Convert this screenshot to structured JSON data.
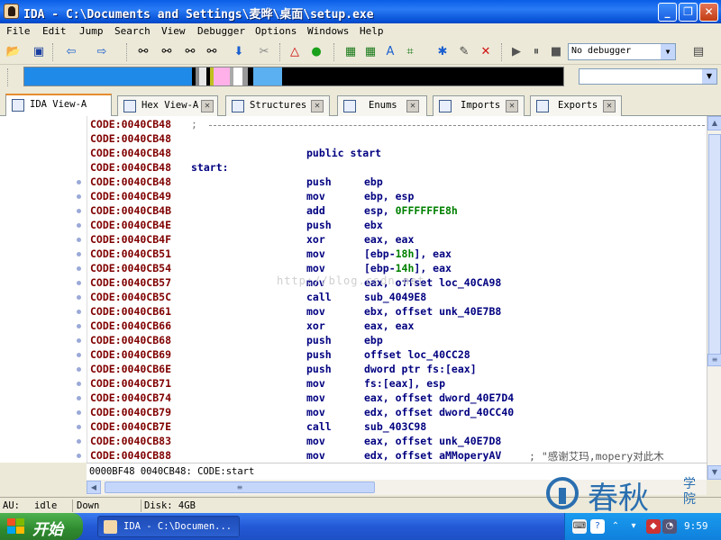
{
  "window": {
    "title": "IDA - C:\\Documents and Settings\\麦晔\\桌面\\setup.exe"
  },
  "menu": [
    "File",
    "Edit",
    "Jump",
    "Search",
    "View",
    "Debugger",
    "Options",
    "Windows",
    "Help"
  ],
  "toolbar": {
    "debugger_select": "No debugger"
  },
  "tabs": [
    {
      "label": "IDA View-A",
      "active": true
    },
    {
      "label": "Hex View-A",
      "active": false
    },
    {
      "label": "Structures",
      "active": false
    },
    {
      "label": "Enums",
      "active": false
    },
    {
      "label": "Imports",
      "active": false
    },
    {
      "label": "Exports",
      "active": false
    }
  ],
  "disasm": {
    "lines": [
      {
        "addr": "CODE:0040CB48",
        "label": ";",
        "mn": "",
        "op": "",
        "sep": true
      },
      {
        "addr": "CODE:0040CB48",
        "label": "",
        "mn": "",
        "op": ""
      },
      {
        "addr": "CODE:0040CB48",
        "label": "",
        "mn": "public start",
        "op": ""
      },
      {
        "addr": "CODE:0040CB48",
        "label": "start:",
        "mn": "",
        "op": ""
      },
      {
        "addr": "CODE:0040CB48",
        "label": "",
        "mn": "push",
        "op": "ebp"
      },
      {
        "addr": "CODE:0040CB49",
        "label": "",
        "mn": "mov",
        "op": "ebp, esp"
      },
      {
        "addr": "CODE:0040CB4B",
        "label": "",
        "mn": "add",
        "op": "esp, ",
        "num": "0FFFFFFE8h",
        "op2": ""
      },
      {
        "addr": "CODE:0040CB4E",
        "label": "",
        "mn": "push",
        "op": "ebx"
      },
      {
        "addr": "CODE:0040CB4F",
        "label": "",
        "mn": "xor",
        "op": "eax, eax"
      },
      {
        "addr": "CODE:0040CB51",
        "label": "",
        "mn": "mov",
        "op": "[ebp-",
        "num": "18h",
        "op2": "], eax"
      },
      {
        "addr": "CODE:0040CB54",
        "label": "",
        "mn": "mov",
        "op": "[ebp-",
        "num": "14h",
        "op2": "], eax"
      },
      {
        "addr": "CODE:0040CB57",
        "label": "",
        "mn": "mov",
        "op": "eax, offset loc_40CA98"
      },
      {
        "addr": "CODE:0040CB5C",
        "label": "",
        "mn": "call",
        "op": "sub_4049E8"
      },
      {
        "addr": "CODE:0040CB61",
        "label": "",
        "mn": "mov",
        "op": "ebx, offset unk_40E7B8"
      },
      {
        "addr": "CODE:0040CB66",
        "label": "",
        "mn": "xor",
        "op": "eax, eax"
      },
      {
        "addr": "CODE:0040CB68",
        "label": "",
        "mn": "push",
        "op": "ebp"
      },
      {
        "addr": "CODE:0040CB69",
        "label": "",
        "mn": "push",
        "op": "offset loc_40CC28"
      },
      {
        "addr": "CODE:0040CB6E",
        "label": "",
        "mn": "push",
        "op": "dword ptr fs:[eax]"
      },
      {
        "addr": "CODE:0040CB71",
        "label": "",
        "mn": "mov",
        "op": "fs:[eax], esp"
      },
      {
        "addr": "CODE:0040CB74",
        "label": "",
        "mn": "mov",
        "op": "eax, offset dword_40E7D4"
      },
      {
        "addr": "CODE:0040CB79",
        "label": "",
        "mn": "mov",
        "op": "edx, offset dword_40CC40"
      },
      {
        "addr": "CODE:0040CB7E",
        "label": "",
        "mn": "call",
        "op": "sub_403C98"
      },
      {
        "addr": "CODE:0040CB83",
        "label": "",
        "mn": "mov",
        "op": "eax, offset unk_40E7D8"
      },
      {
        "addr": "CODE:0040CB88",
        "label": "",
        "mn": "mov",
        "op": "edx, offset aMMoperyAV",
        "comment": "; \"感谢艾玛,mopery对此木"
      }
    ],
    "watermark": "http://blog.csdn.net"
  },
  "view_status": "0000BF48 0040CB48: CODE:start",
  "statusbar": {
    "au_label": "AU:",
    "au_state": "idle",
    "direction": "Down",
    "disk": "Disk: 4GB"
  },
  "logo": {
    "name": "春秋",
    "sub": "学院"
  },
  "taskbar": {
    "start": "开始",
    "task": "IDA - C:\\Documen...",
    "clock": "9:59"
  },
  "colors": {
    "address": "#800000",
    "code": "#000080",
    "number": "#008000",
    "titlebar": "#0a5ee6",
    "taskbar": "#2359d6"
  }
}
